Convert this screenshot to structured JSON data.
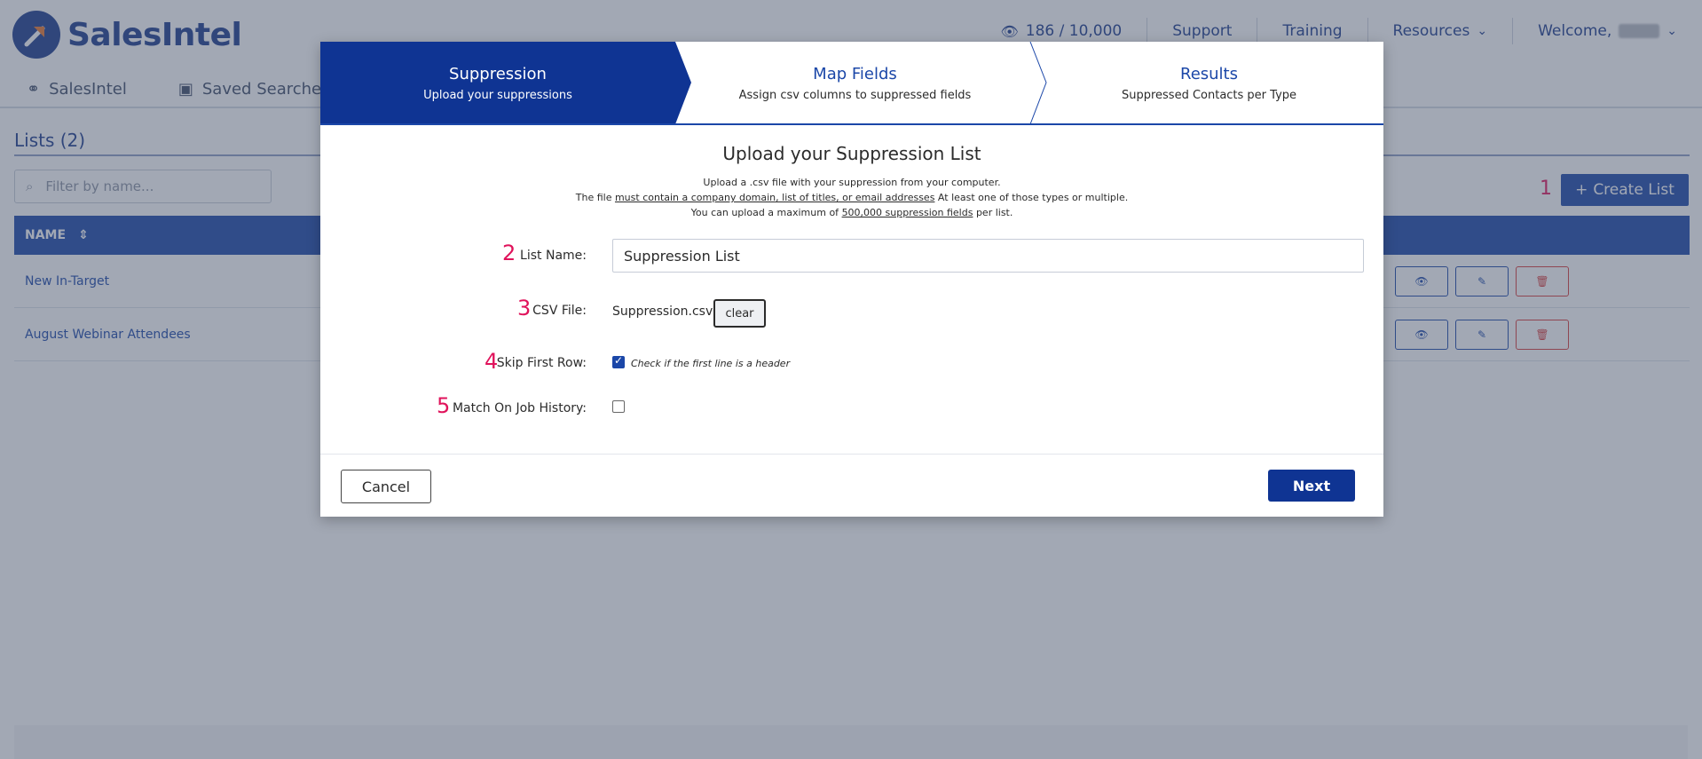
{
  "app": {
    "logo_text": "SalesIntel",
    "credits": "186 / 10,000",
    "nav": [
      "Support",
      "Training",
      "Resources"
    ],
    "welcome": "Welcome,"
  },
  "subnav": {
    "tabs": [
      "SalesIntel",
      "Saved Searches"
    ]
  },
  "lists": {
    "title": "Lists (2)",
    "filter_placeholder": "Filter by name...",
    "create_annotation": "1",
    "create_label": "Create List",
    "column_name": "NAME",
    "rows": [
      "New In-Target",
      "August Webinar Attendees"
    ]
  },
  "modal": {
    "steps": [
      {
        "title": "Suppression",
        "subtitle": "Upload your suppressions"
      },
      {
        "title": "Map Fields",
        "subtitle": "Assign csv columns to suppressed fields"
      },
      {
        "title": "Results",
        "subtitle": "Suppressed Contacts per Type"
      }
    ],
    "active_step": 0,
    "heading": "Upload your Suppression List",
    "desc_line1": "Upload a .csv file with your suppression from your computer.",
    "desc_line2_a": "The file ",
    "desc_line2_link": "must contain a company domain, list of titles, or email addresses",
    "desc_line2_b": " At least one of those types or multiple.",
    "desc_line3_a": "You can upload a maximum of ",
    "desc_line3_link": "500,000 suppression fields",
    "desc_line3_b": " per list.",
    "fields": {
      "list_name": {
        "num": "2",
        "label": "List Name:",
        "value": "Suppression List"
      },
      "csv_file": {
        "num": "3",
        "label": "CSV File:",
        "value": "Suppression.csv",
        "clear_label": "clear"
      },
      "skip_first_row": {
        "num": "4",
        "label": "Skip First Row:",
        "checked": true,
        "help": "Check if the first line is a header"
      },
      "match_job_history": {
        "num": "5",
        "label": "Match On Job History:",
        "checked": false
      }
    },
    "cancel_label": "Cancel",
    "next_label": "Next"
  },
  "colors": {
    "brand": "#1b47a8",
    "annotation": "#e0135b",
    "next": "#0f3493"
  }
}
